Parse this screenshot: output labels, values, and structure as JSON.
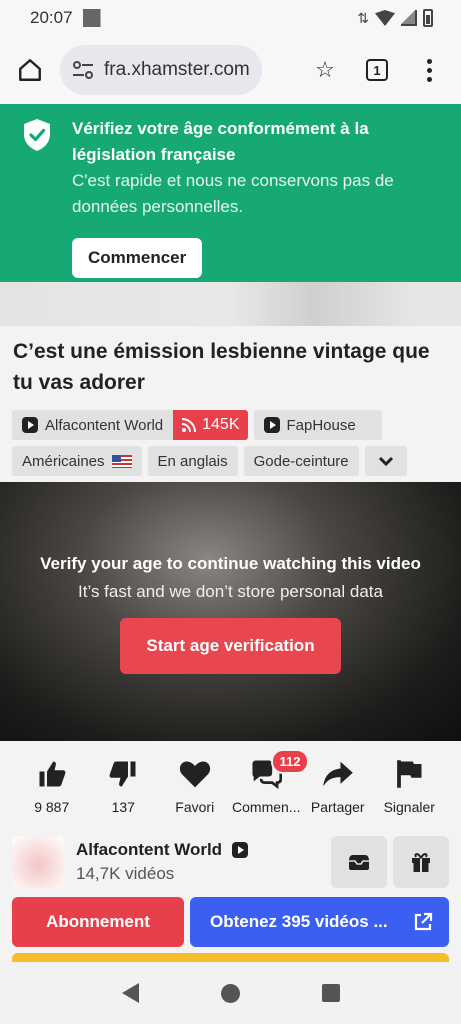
{
  "status": {
    "time": "20:07"
  },
  "browser": {
    "url_prefix": "fra.xhamster.com",
    "tab_count": "1"
  },
  "banner": {
    "title": "Vérifiez votre âge conformément à la législation française",
    "description": "C'est rapide et nous ne conservons pas de données personnelles.",
    "button": "Commencer"
  },
  "video": {
    "title": "C’est une émission lesbienne vintage que tu vas adorer",
    "channel_tag": "Alfacontent World",
    "channel_subs": "145K",
    "studio_tag": "FapHouse",
    "tags": [
      "Américaines",
      "En anglais",
      "Gode-ceinture"
    ]
  },
  "player": {
    "title": "Verify your age to continue watching this video",
    "subtitle": "It’s fast and we don’t store personal data",
    "button": "Start age verification"
  },
  "actions": [
    {
      "label": "9 887",
      "icon": "thumbs-up-icon"
    },
    {
      "label": "137",
      "icon": "thumbs-down-icon"
    },
    {
      "label": "Favori",
      "icon": "heart-icon"
    },
    {
      "label": "Commen...",
      "icon": "comments-icon",
      "badge": "112"
    },
    {
      "label": "Partager",
      "icon": "share-icon"
    },
    {
      "label": "Signaler",
      "icon": "flag-icon"
    }
  ],
  "channel": {
    "name": "Alfacontent World",
    "count": "14,7K vidéos",
    "subscribe": "Abonnement",
    "more": "Obtenez 395 vidéos ..."
  },
  "colors": {
    "banner": "#16a974",
    "red": "#e8404b",
    "blue": "#3b5ff0",
    "yellow": "#f6bd2a"
  }
}
